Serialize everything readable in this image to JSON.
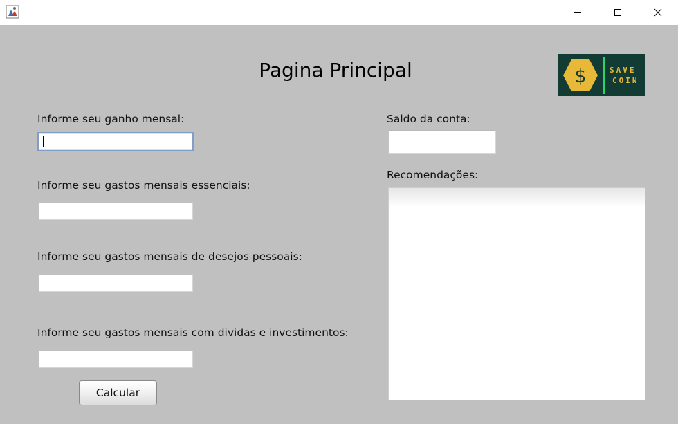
{
  "window": {
    "icon": "java-app-icon",
    "controls": {
      "minimize": "minimize-icon",
      "maximize": "maximize-icon",
      "close": "close-icon"
    }
  },
  "main": {
    "title": "Pagina Principal"
  },
  "logo": {
    "line1": "SAVE",
    "line2": "COIN",
    "symbol": "$",
    "colors": {
      "background": "#123b33",
      "hexagon": "#e8b838",
      "accent_bar": "#2ed36b"
    }
  },
  "form": {
    "income": {
      "label": "Informe seu ganho mensal:",
      "value": ""
    },
    "essential": {
      "label": "Informe seu gastos mensais essenciais:",
      "value": ""
    },
    "personal": {
      "label": "Informe seu gastos mensais de desejos pessoais:",
      "value": ""
    },
    "debts": {
      "label": "Informe seu gastos mensais com dividas e investimentos:",
      "value": ""
    },
    "calculate_label": "Calcular"
  },
  "result": {
    "balance_label": "Saldo da conta:",
    "balance_value": "",
    "recommendations_label": "Recomendações:",
    "recommendations_value": ""
  },
  "colors": {
    "window_background": "#c0c0c0",
    "titlebar_background": "#ffffff",
    "focus_border": "#7f9fc8"
  }
}
